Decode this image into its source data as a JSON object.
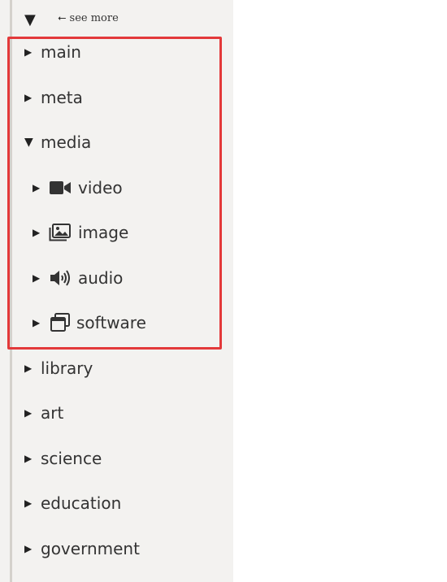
{
  "header": {
    "toggle_glyph": "▼",
    "see_more_label": "⭠ see more"
  },
  "tree": {
    "main": {
      "label": "main",
      "arrow": "▶"
    },
    "meta": {
      "label": "meta",
      "arrow": "▶"
    },
    "media": {
      "label": "media",
      "arrow": "▼",
      "children": {
        "video": {
          "label": "video",
          "arrow": "▶",
          "icon": "video-camera-icon"
        },
        "image": {
          "label": "image",
          "arrow": "▶",
          "icon": "image-icon"
        },
        "audio": {
          "label": "audio",
          "arrow": "▶",
          "icon": "speaker-icon"
        },
        "software": {
          "label": "software",
          "arrow": "▶",
          "icon": "window-icon"
        }
      }
    },
    "library": {
      "label": "library",
      "arrow": "▶"
    },
    "art": {
      "label": "art",
      "arrow": "▶"
    },
    "science": {
      "label": "science",
      "arrow": "▶"
    },
    "education": {
      "label": "education",
      "arrow": "▶"
    },
    "government": {
      "label": "government",
      "arrow": "▶"
    }
  },
  "colors": {
    "panel_background": "#f3f2f0",
    "highlight_border": "#e3393a",
    "text": "#333333"
  }
}
